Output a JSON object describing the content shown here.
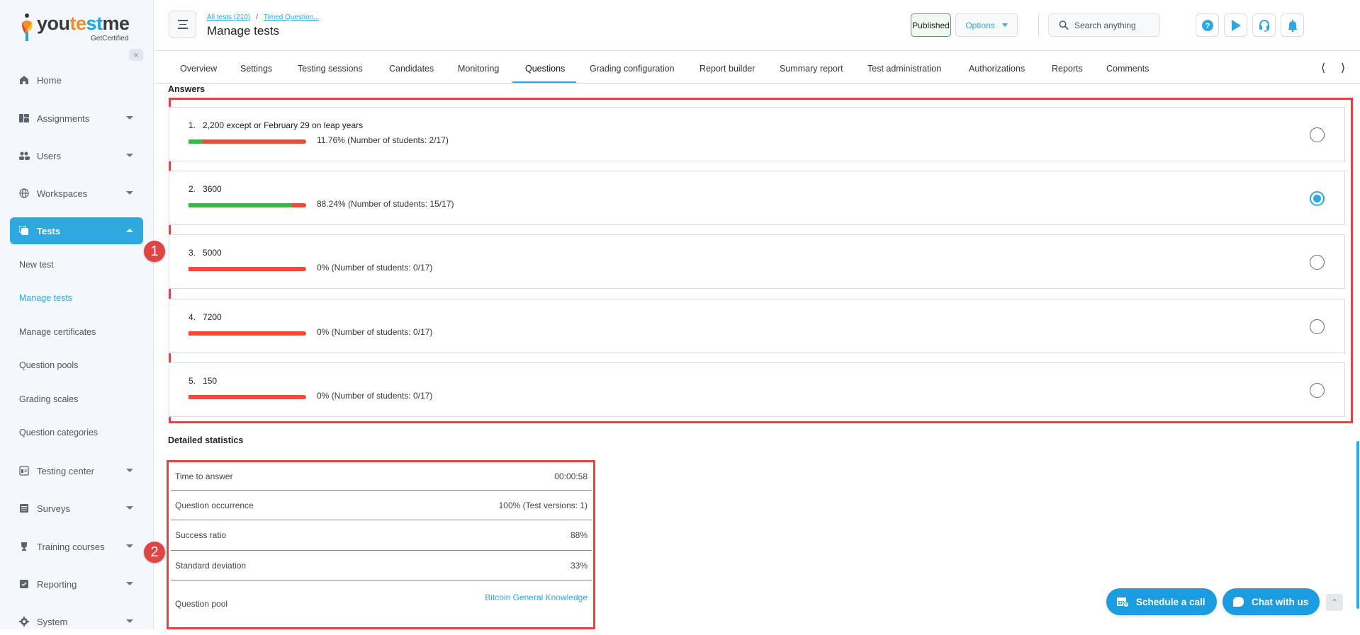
{
  "brand": {
    "logo_text_1": "you",
    "logo_text_2": "te",
    "logo_text_3": "st",
    "logo_text_4": "me",
    "tagline": "GetCertified"
  },
  "sidebar": {
    "collapse_icon": "double-chevron-left",
    "items": [
      {
        "label": "Home",
        "icon": "home-icon",
        "has_caret": false
      },
      {
        "label": "Assignments",
        "icon": "dashboard-icon",
        "has_caret": true
      },
      {
        "label": "Users",
        "icon": "users-icon",
        "has_caret": true
      },
      {
        "label": "Workspaces",
        "icon": "globe-icon",
        "has_caret": true
      },
      {
        "label": "Tests",
        "icon": "copy-icon",
        "has_caret": true,
        "active": true
      },
      {
        "label": "Testing center",
        "icon": "calendar-icon",
        "has_caret": true
      },
      {
        "label": "Surveys",
        "icon": "list-icon",
        "has_caret": true
      },
      {
        "label": "Training courses",
        "icon": "trophy-icon",
        "has_caret": true
      },
      {
        "label": "Reporting",
        "icon": "report-icon",
        "has_caret": true
      },
      {
        "label": "System",
        "icon": "gear-icon",
        "has_caret": true
      }
    ],
    "tests_subitems": [
      {
        "label": "New test"
      },
      {
        "label": "Manage tests",
        "current": true
      },
      {
        "label": "Manage certificates"
      },
      {
        "label": "Question pools"
      },
      {
        "label": "Grading scales"
      },
      {
        "label": "Question categories"
      }
    ]
  },
  "header": {
    "breadcrumb": [
      {
        "label": "All tests (210)"
      },
      {
        "label": "Timed Question..."
      }
    ],
    "breadcrumb_sep": "/",
    "title": "Manage tests",
    "status_badge": "Published",
    "options_label": "Options",
    "search_placeholder": "Search anything",
    "icon_buttons": [
      "help-icon",
      "play-icon",
      "headset-icon",
      "bell-icon"
    ]
  },
  "tabs": [
    {
      "label": "Overview"
    },
    {
      "label": "Settings"
    },
    {
      "label": "Testing sessions"
    },
    {
      "label": "Candidates"
    },
    {
      "label": "Monitoring"
    },
    {
      "label": "Questions",
      "active": true
    },
    {
      "label": "Grading configuration"
    },
    {
      "label": "Report builder"
    },
    {
      "label": "Summary report"
    },
    {
      "label": "Test administration"
    },
    {
      "label": "Authorizations"
    },
    {
      "label": "Reports"
    },
    {
      "label": "Comments"
    }
  ],
  "answers": {
    "heading": "Answers",
    "items": [
      {
        "num": "1.",
        "text": "2,200 except or February 29 on leap years",
        "percent": 11.76,
        "stats": "11.76% (Number of students: 2/17)",
        "correct": false
      },
      {
        "num": "2.",
        "text": "3600",
        "percent": 88.24,
        "stats": "88.24% (Number of students: 15/17)",
        "correct": true
      },
      {
        "num": "3.",
        "text": "5000",
        "percent": 0,
        "stats": "0% (Number of students: 0/17)",
        "correct": false
      },
      {
        "num": "4.",
        "text": "7200",
        "percent": 0,
        "stats": "0% (Number of students: 0/17)",
        "correct": false
      },
      {
        "num": "5.",
        "text": "150",
        "percent": 0,
        "stats": "0% (Number of students: 0/17)",
        "correct": false
      }
    ]
  },
  "markers": {
    "one": "1",
    "two": "2"
  },
  "detailed_statistics": {
    "heading": "Detailed statistics",
    "rows": [
      {
        "label": "Time to answer",
        "value": "00:00:58"
      },
      {
        "label": "Question occurrence",
        "value": "100% (Test versions: 1)"
      },
      {
        "label": "Success ratio",
        "value": "88%"
      },
      {
        "label": "Standard deviation",
        "value": "33%"
      },
      {
        "label": "Question pool",
        "value": "Bitcoin General Knowledge",
        "is_link": true
      }
    ]
  },
  "floating": {
    "schedule_label": "Schedule a call",
    "chat_label": "Chat with us"
  },
  "colors": {
    "accent": "#2ea8df",
    "correct_bar": "#34b94a",
    "incorrect_bar": "#f14a39",
    "annotation": "#e04444"
  }
}
